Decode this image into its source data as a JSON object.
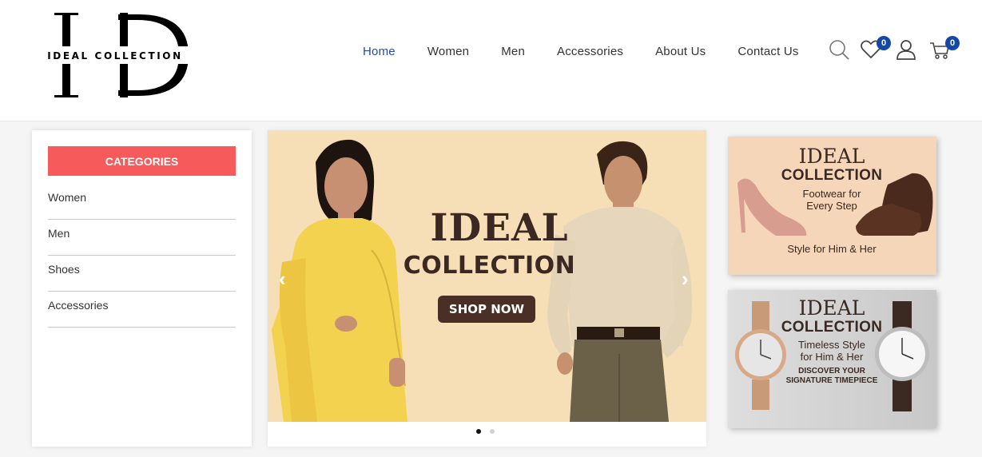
{
  "brand": {
    "name": "IDEAL COLLECTION",
    "monogram_left": "I",
    "monogram_right": "D"
  },
  "nav": {
    "items": [
      {
        "label": "Home",
        "active": true
      },
      {
        "label": "Women"
      },
      {
        "label": "Men"
      },
      {
        "label": "Accessories"
      },
      {
        "label": "About Us"
      },
      {
        "label": "Contact Us"
      }
    ]
  },
  "header_icons": {
    "wishlist_count": "0",
    "cart_count": "0"
  },
  "sidebar": {
    "title": "CATEGORIES",
    "items": [
      "Women",
      "Men",
      "Shoes",
      "Accessories"
    ]
  },
  "hero": {
    "title": "IDEAL",
    "subtitle": "COLLECTION",
    "cta": "SHOP NOW",
    "prev_arrow": "‹",
    "next_arrow": "›"
  },
  "promo1": {
    "title": "IDEAL",
    "subtitle": "COLLECTION",
    "line1": "Footwear for",
    "line2": "Every Step",
    "footer": "Style for Him & Her"
  },
  "promo2": {
    "title": "IDEAL",
    "subtitle": "COLLECTION",
    "line1": "Timeless Style",
    "line2": "for Him & Her",
    "line3": "DISCOVER YOUR",
    "line4": "SIGNATURE TIMEPIECE"
  },
  "colors": {
    "accent": "#f65a5a",
    "nav_active": "#1f4e9c",
    "badge": "#1547a8",
    "hero_bg": "#f6dfb6"
  }
}
